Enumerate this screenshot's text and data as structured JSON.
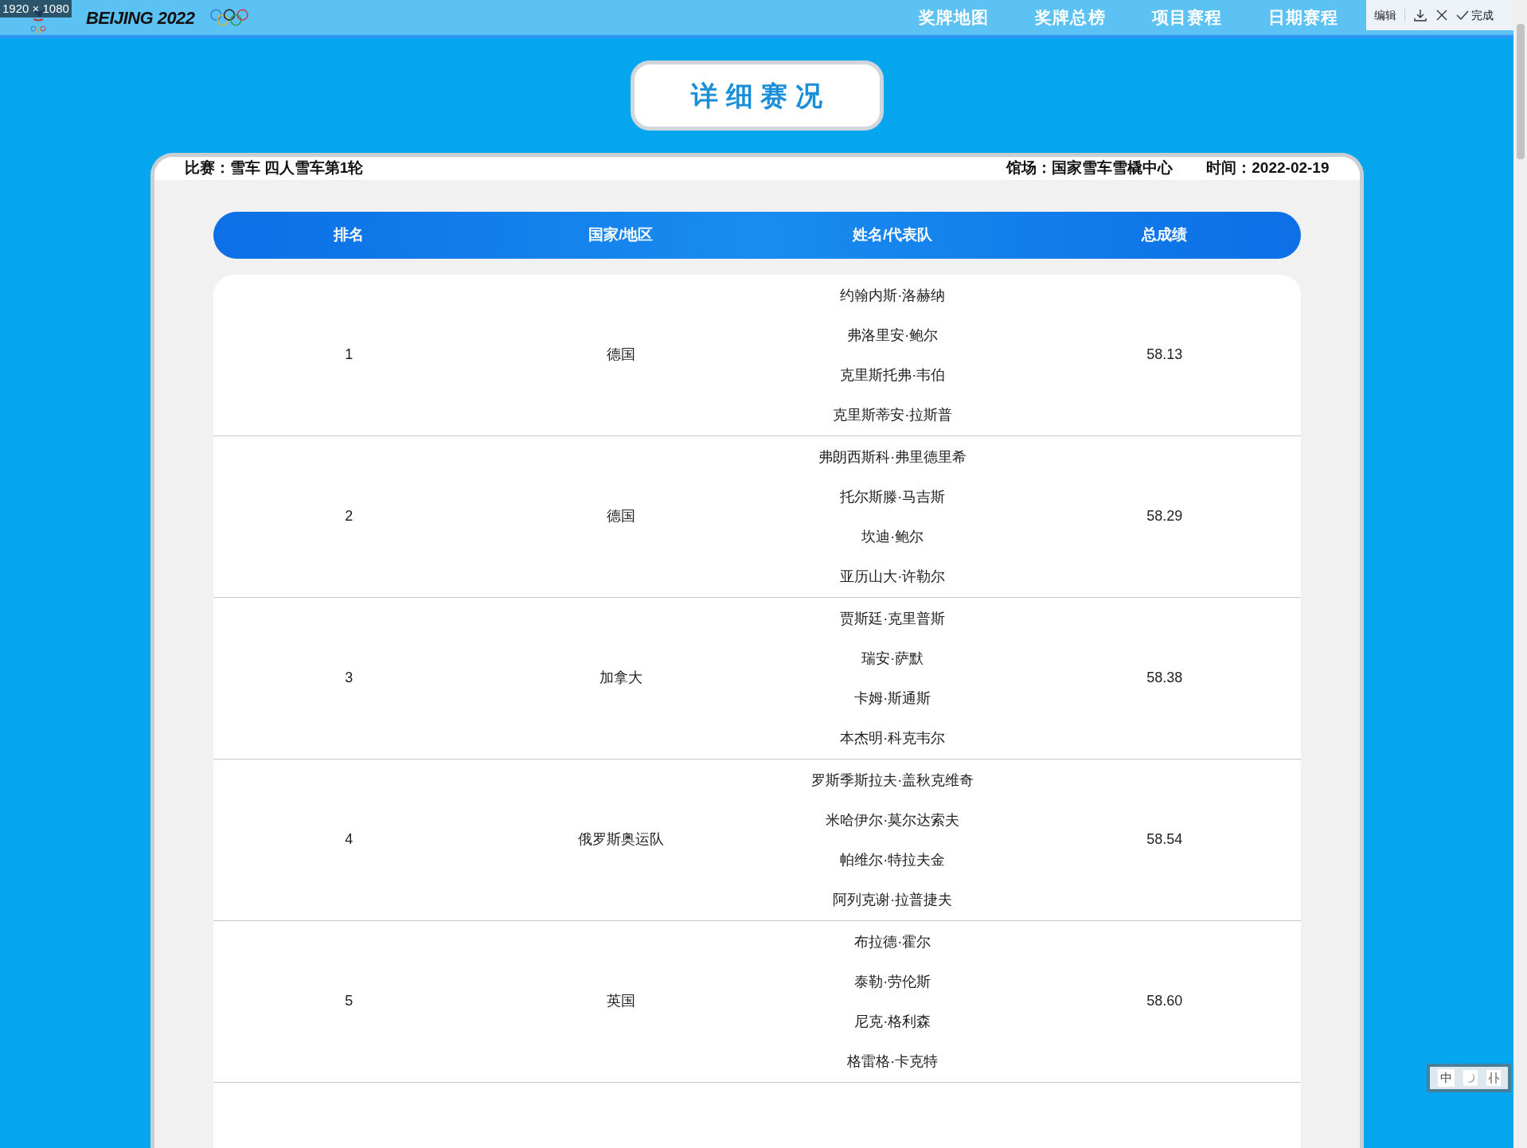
{
  "overlay": {
    "dimensions": "1920 × 1080"
  },
  "top_bar": {
    "logo_text": "BEIJING 2022",
    "nav": [
      {
        "label": "奖牌地图"
      },
      {
        "label": "奖牌总榜"
      },
      {
        "label": "项目赛程"
      },
      {
        "label": "日期赛程"
      }
    ]
  },
  "capture_toolbar": {
    "edit": "编辑",
    "done": "完成"
  },
  "title": "详 细 赛 况",
  "info": {
    "event": "比赛：雪车 四人雪车第1轮",
    "venue": "馆场：国家雪车雪橇中心",
    "date": "时间：2022-02-19"
  },
  "table": {
    "columns": [
      "排名",
      "国家/地区",
      "姓名/代表队",
      "总成绩"
    ],
    "rows": [
      {
        "rank": "1",
        "country": "德国",
        "names": [
          "约翰内斯·洛赫纳",
          "弗洛里安·鲍尔",
          "克里斯托弗·韦伯",
          "克里斯蒂安·拉斯普"
        ],
        "score": "58.13"
      },
      {
        "rank": "2",
        "country": "德国",
        "names": [
          "弗朗西斯科·弗里德里希",
          "托尔斯滕·马吉斯",
          "坎迪·鲍尔",
          "亚历山大·许勒尔"
        ],
        "score": "58.29"
      },
      {
        "rank": "3",
        "country": "加拿大",
        "names": [
          "贾斯廷·克里普斯",
          "瑞安·萨默",
          "卡姆·斯通斯",
          "本杰明·科克韦尔"
        ],
        "score": "58.38"
      },
      {
        "rank": "4",
        "country": "俄罗斯奥运队",
        "names": [
          "罗斯季斯拉夫·盖秋克维奇",
          "米哈伊尔·莫尔达索夫",
          "帕维尔·特拉夫金",
          "阿列克谢·拉普捷夫"
        ],
        "score": "58.54"
      },
      {
        "rank": "5",
        "country": "英国",
        "names": [
          "布拉德·霍尔",
          "泰勒·劳伦斯",
          "尼克·格利森",
          "格雷格·卡克特"
        ],
        "score": "58.60"
      }
    ]
  },
  "ime_bar": {
    "mode": "中"
  }
}
